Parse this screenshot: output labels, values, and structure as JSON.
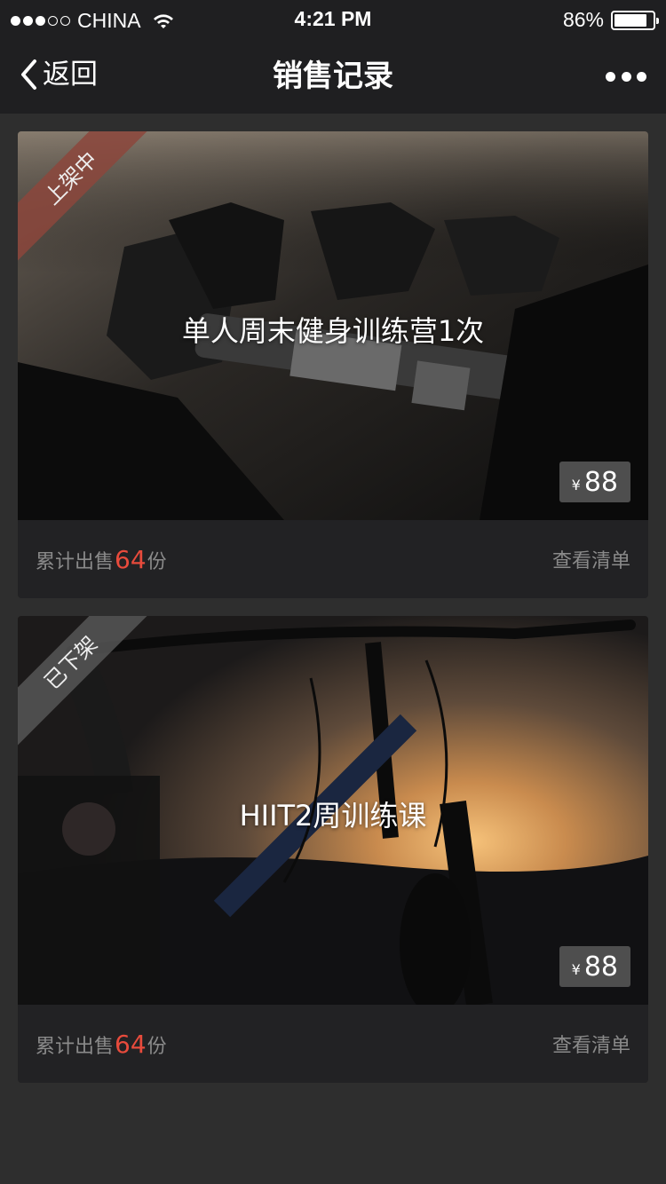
{
  "status_bar": {
    "carrier": "CHINA",
    "time": "4:21 PM",
    "battery": "86%",
    "battery_level": 0.86
  },
  "nav": {
    "back_label": "返回",
    "title": "销售记录",
    "more_icon": "more-dots-icon"
  },
  "cards": [
    {
      "status_label": "上架中",
      "title": "单人周末健身训练营1次",
      "price_symbol": "¥",
      "price": "88",
      "sales_prefix": "累计出售",
      "sales_count": "64",
      "sales_suffix": "份",
      "action_label": "查看清单"
    },
    {
      "status_label": "已下架",
      "title": "HIIT2周训练课",
      "price_symbol": "¥",
      "price": "88",
      "sales_prefix": "累计出售",
      "sales_count": "64",
      "sales_suffix": "份",
      "action_label": "查看清单"
    }
  ],
  "colors": {
    "background": "#2e2e2e",
    "bar": "#1f1f21",
    "card": "#222224",
    "accent": "#e84b3c",
    "muted_text": "#8a8a8a"
  }
}
